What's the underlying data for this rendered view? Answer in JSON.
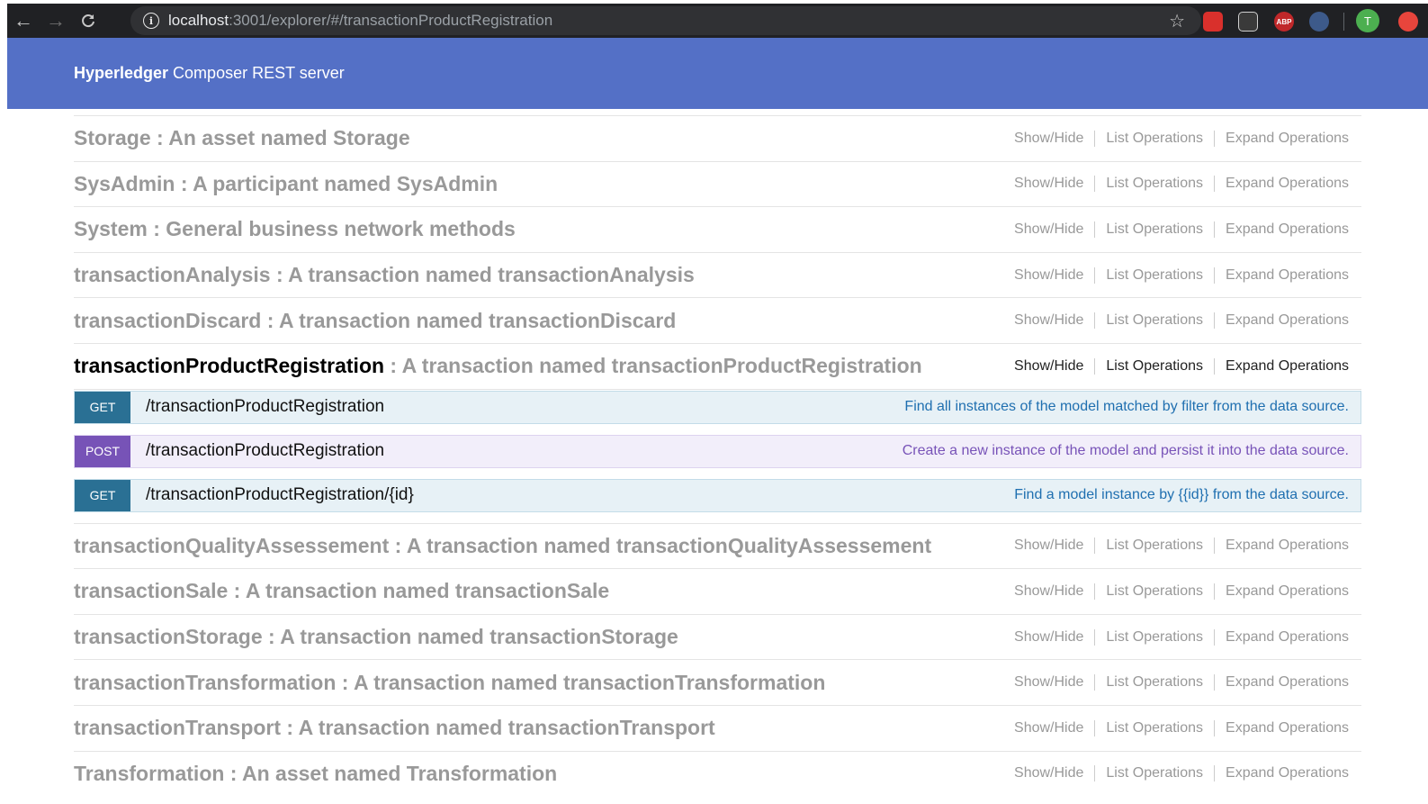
{
  "browser": {
    "url_host": "localhost",
    "url_path": ":3001/explorer/#/transactionProductRegistration",
    "back_icon": "←",
    "forward_icon": "→",
    "reload_icon": "C",
    "star_icon": "☆",
    "abp_label": "ABP",
    "avatar_letter": "T"
  },
  "header": {
    "title_bold": "Hyperledger",
    "title_rest": " Composer REST server"
  },
  "ops_labels": {
    "show_hide": "Show/Hide",
    "list_operations": "List Operations",
    "expand_operations": "Expand Operations"
  },
  "resources_before": [
    {
      "name": "Storage",
      "desc": " : An asset named Storage"
    },
    {
      "name": "SysAdmin",
      "desc": " : A participant named SysAdmin"
    },
    {
      "name": "System",
      "desc": " : General business network methods"
    },
    {
      "name": "transactionAnalysis",
      "desc": " : A transaction named transactionAnalysis"
    },
    {
      "name": "transactionDiscard",
      "desc": " : A transaction named transactionDiscard"
    }
  ],
  "active_resource": {
    "name": "transactionProductRegistration",
    "desc": " : A transaction named transactionProductRegistration",
    "endpoints": [
      {
        "method": "GET",
        "path": "/transactionProductRegistration",
        "summary": "Find all instances of the model matched by filter from the data source."
      },
      {
        "method": "POST",
        "path": "/transactionProductRegistration",
        "summary": "Create a new instance of the model and persist it into the data source."
      },
      {
        "method": "GET",
        "path": "/transactionProductRegistration/{id}",
        "summary": "Find a model instance by {{id}} from the data source."
      }
    ]
  },
  "resources_after": [
    {
      "name": "transactionQualityAssessement",
      "desc": " : A transaction named transactionQualityAssessement"
    },
    {
      "name": "transactionSale",
      "desc": " : A transaction named transactionSale"
    },
    {
      "name": "transactionStorage",
      "desc": " : A transaction named transactionStorage"
    },
    {
      "name": "transactionTransformation",
      "desc": " : A transaction named transactionTransformation"
    },
    {
      "name": "transactionTransport",
      "desc": " : A transaction named transactionTransport"
    },
    {
      "name": "Transformation",
      "desc": " : An asset named Transformation"
    }
  ]
}
